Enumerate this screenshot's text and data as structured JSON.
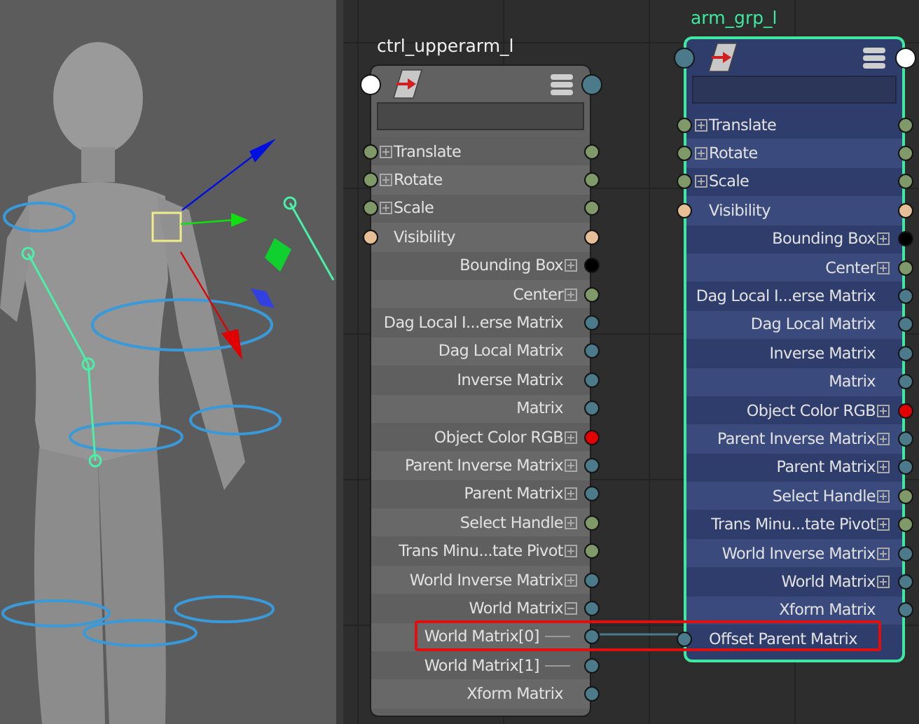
{
  "nodes": [
    {
      "name": "ctrl_upperarm_l",
      "selected": false,
      "in_port": {
        "color": "#ffffff"
      },
      "out_port": {
        "color": "#4b7b8b"
      },
      "rows": [
        {
          "label": "Translate",
          "kind": "input",
          "expanded": false,
          "in_port": {
            "color": "#7f9a68"
          },
          "out_port": {
            "color": "#7f9a68"
          }
        },
        {
          "label": "Rotate",
          "kind": "input",
          "expanded": false,
          "in_port": {
            "color": "#7f9a68"
          },
          "out_port": {
            "color": "#7f9a68"
          }
        },
        {
          "label": "Scale",
          "kind": "input",
          "expanded": false,
          "in_port": {
            "color": "#7f9a68"
          },
          "out_port": {
            "color": "#7f9a68"
          }
        },
        {
          "label": "Visibility",
          "kind": "input",
          "in_port": {
            "color": "#e6bf96"
          },
          "out_port": {
            "color": "#e6bf96"
          }
        },
        {
          "label": "Bounding Box",
          "kind": "output",
          "expanded": false,
          "out_port": {
            "color": "#000000"
          }
        },
        {
          "label": "Center",
          "kind": "output",
          "expanded": false,
          "out_port": {
            "color": "#7f9a68"
          }
        },
        {
          "label": "Dag Local I...erse Matrix",
          "kind": "output",
          "out_port": {
            "color": "#4b7b8b"
          }
        },
        {
          "label": "Dag Local Matrix",
          "kind": "output",
          "out_port": {
            "color": "#4b7b8b"
          }
        },
        {
          "label": "Inverse Matrix",
          "kind": "output",
          "out_port": {
            "color": "#4b7b8b"
          }
        },
        {
          "label": "Matrix",
          "kind": "output",
          "out_port": {
            "color": "#4b7b8b"
          }
        },
        {
          "label": "Object Color RGB",
          "kind": "output",
          "expanded": false,
          "out_port": {
            "color": "#e30000"
          }
        },
        {
          "label": "Parent Inverse Matrix",
          "kind": "output",
          "expanded": false,
          "out_port": {
            "color": "#4b7b8b"
          }
        },
        {
          "label": "Parent Matrix",
          "kind": "output",
          "expanded": false,
          "out_port": {
            "color": "#4b7b8b"
          }
        },
        {
          "label": "Select Handle",
          "kind": "output",
          "expanded": false,
          "out_port": {
            "color": "#7f9a68"
          }
        },
        {
          "label": "Trans Minu...tate Pivot",
          "kind": "output",
          "expanded": false,
          "out_port": {
            "color": "#7f9a68"
          }
        },
        {
          "label": "World Inverse Matrix",
          "kind": "output",
          "expanded": false,
          "out_port": {
            "color": "#4b7b8b"
          }
        },
        {
          "label": "World Matrix",
          "kind": "output",
          "expanded": true,
          "out_port": {
            "color": "#4b7b8b"
          }
        },
        {
          "label": "World Matrix[0]",
          "kind": "child",
          "out_port": {
            "color": "#4b7b8b"
          }
        },
        {
          "label": "World Matrix[1]",
          "kind": "child",
          "out_port": {
            "color": "#4b7b8b"
          }
        },
        {
          "label": "Xform Matrix",
          "kind": "output",
          "out_port": {
            "color": "#4b7b8b"
          }
        }
      ]
    },
    {
      "name": "arm_grp_l",
      "selected": true,
      "in_port": {
        "color": "#4b7b8b"
      },
      "out_port": {
        "color": "#ffffff"
      },
      "rows": [
        {
          "label": "Translate",
          "kind": "input",
          "expanded": false,
          "in_port": {
            "color": "#7f9a68"
          },
          "out_port": {
            "color": "#7f9a68"
          }
        },
        {
          "label": "Rotate",
          "kind": "input",
          "expanded": false,
          "in_port": {
            "color": "#7f9a68"
          },
          "out_port": {
            "color": "#7f9a68"
          }
        },
        {
          "label": "Scale",
          "kind": "input",
          "expanded": false,
          "in_port": {
            "color": "#7f9a68"
          },
          "out_port": {
            "color": "#7f9a68"
          }
        },
        {
          "label": "Visibility",
          "kind": "input",
          "in_port": {
            "color": "#e6bf96"
          },
          "out_port": {
            "color": "#e6bf96"
          }
        },
        {
          "label": "Bounding Box",
          "kind": "output",
          "expanded": false,
          "out_port": {
            "color": "#000000"
          }
        },
        {
          "label": "Center",
          "kind": "output",
          "expanded": false,
          "out_port": {
            "color": "#7f9a68"
          }
        },
        {
          "label": "Dag Local I...erse Matrix",
          "kind": "output",
          "out_port": {
            "color": "#4b7b8b"
          }
        },
        {
          "label": "Dag Local Matrix",
          "kind": "output",
          "out_port": {
            "color": "#4b7b8b"
          }
        },
        {
          "label": "Inverse Matrix",
          "kind": "output",
          "out_port": {
            "color": "#4b7b8b"
          }
        },
        {
          "label": "Matrix",
          "kind": "output",
          "out_port": {
            "color": "#4b7b8b"
          }
        },
        {
          "label": "Object Color RGB",
          "kind": "output",
          "expanded": false,
          "out_port": {
            "color": "#e30000"
          }
        },
        {
          "label": "Parent Inverse Matrix",
          "kind": "output",
          "expanded": false,
          "out_port": {
            "color": "#4b7b8b"
          }
        },
        {
          "label": "Parent Matrix",
          "kind": "output",
          "expanded": false,
          "out_port": {
            "color": "#4b7b8b"
          }
        },
        {
          "label": "Select Handle",
          "kind": "output",
          "expanded": false,
          "out_port": {
            "color": "#7f9a68"
          }
        },
        {
          "label": "Trans Minu...tate Pivot",
          "kind": "output",
          "expanded": false,
          "out_port": {
            "color": "#7f9a68"
          }
        },
        {
          "label": "World Inverse Matrix",
          "kind": "output",
          "expanded": false,
          "out_port": {
            "color": "#4b7b8b"
          }
        },
        {
          "label": "World Matrix",
          "kind": "output",
          "expanded": false,
          "out_port": {
            "color": "#4b7b8b"
          }
        },
        {
          "label": "Xform Matrix",
          "kind": "output",
          "out_port": {
            "color": "#4b7b8b"
          }
        },
        {
          "label": "Offset Parent Matrix",
          "kind": "input",
          "in_port": {
            "color": "#4b7b8b"
          }
        }
      ]
    }
  ],
  "connection": {
    "highlighted": true
  }
}
